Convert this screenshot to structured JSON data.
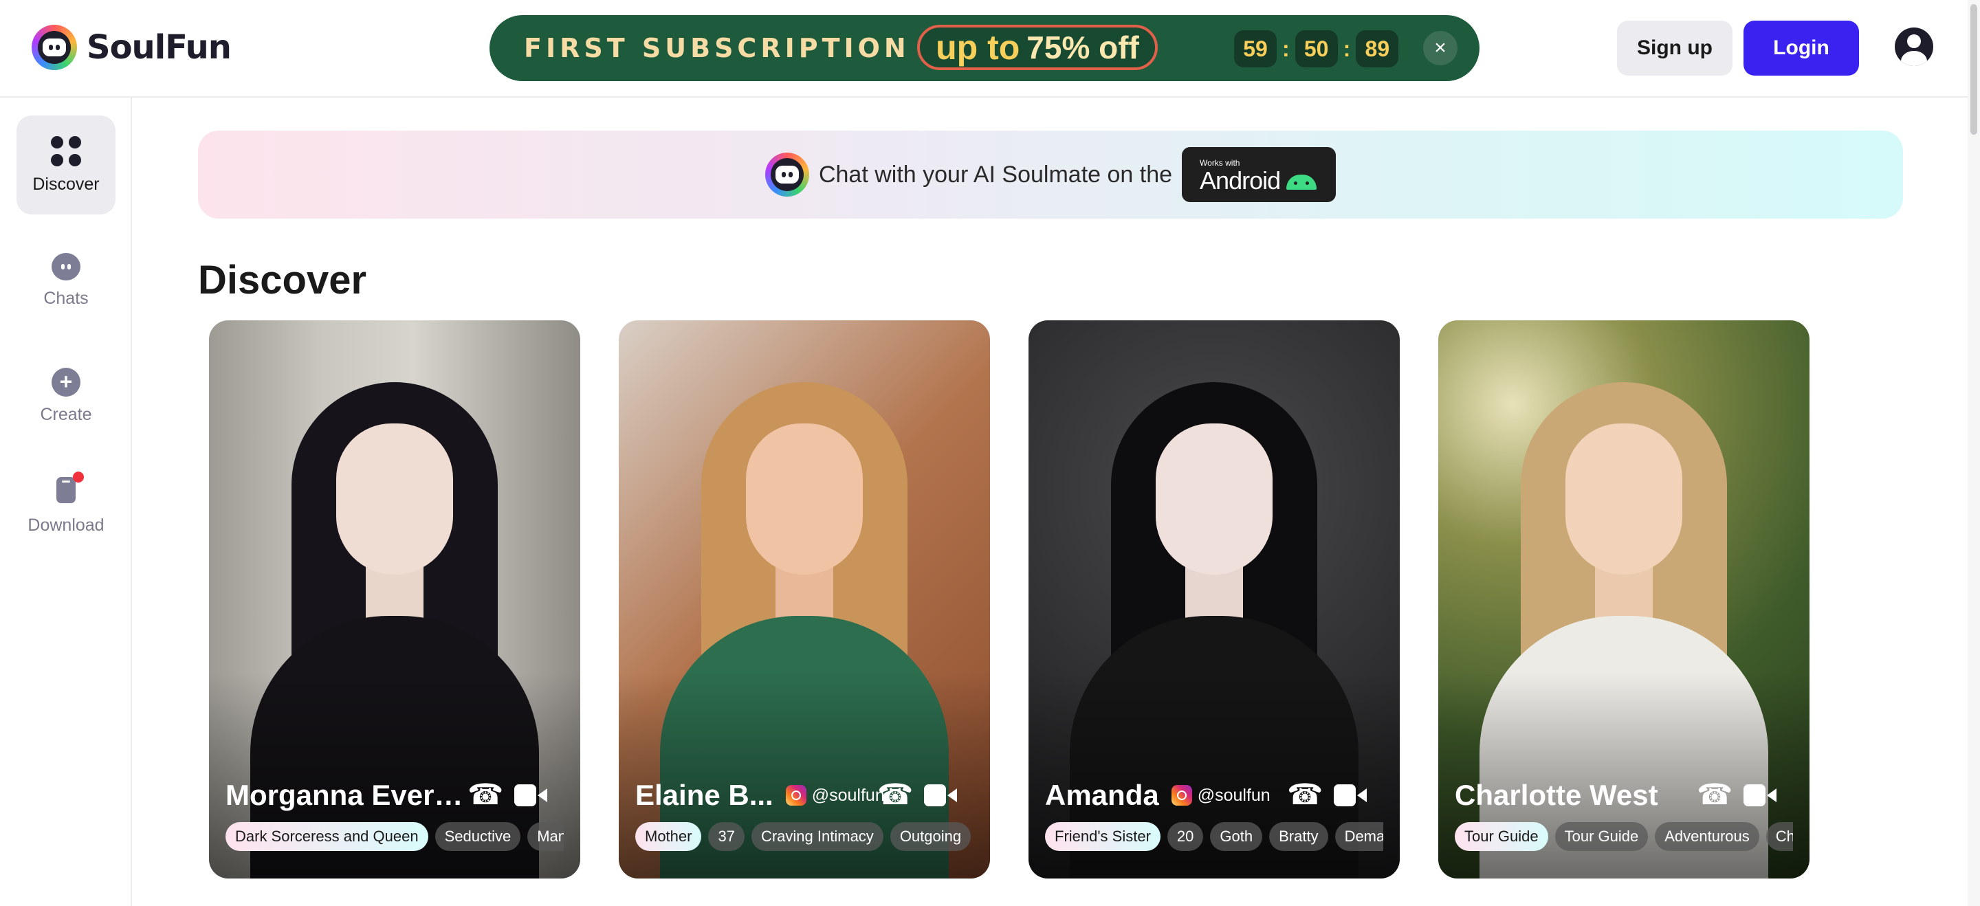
{
  "header": {
    "logo_text": "SoulFun",
    "promo": {
      "title": "FIRST SUBSCRIPTION",
      "up_to": "up to",
      "off": "75% off",
      "countdown": [
        "59",
        "50",
        "89"
      ],
      "close_label": "×"
    },
    "signup_label": "Sign up",
    "login_label": "Login"
  },
  "sidebar": {
    "items": [
      {
        "label": "Discover",
        "icon": "grid-icon",
        "active": true
      },
      {
        "label": "Chats",
        "icon": "chat-icon"
      },
      {
        "label": "Create",
        "icon": "plus-circle-icon"
      },
      {
        "label": "Download",
        "icon": "phone-icon",
        "badge": "red-dot"
      }
    ]
  },
  "banner": {
    "text": "Chat with your AI Soulmate on the",
    "badge_small": "Works with",
    "badge_big": "Android"
  },
  "main": {
    "title": "Discover"
  },
  "cards": [
    {
      "name": "Morganna Everni...",
      "handle": "",
      "tags": [
        "Dark Sorceress and Queen",
        "Seductive",
        "Manip"
      ]
    },
    {
      "name": "Elaine B...",
      "handle": "@soulfun",
      "tags": [
        "Mother",
        "37",
        "Craving Intimacy",
        "Outgoing",
        ""
      ]
    },
    {
      "name": "Amanda",
      "handle": "@soulfun",
      "tags": [
        "Friend's Sister",
        "20",
        "Goth",
        "Bratty",
        "Demanc"
      ]
    },
    {
      "name": "Charlotte West",
      "handle": "",
      "tags": [
        "Tour Guide",
        "Tour Guide",
        "Adventurous",
        "Char"
      ]
    }
  ],
  "colors": {
    "accent": "#3a22f0",
    "promo_bg": "#1e5a3c",
    "promo_gold": "#f7cf5a",
    "nav_active_bg": "#ececf0"
  }
}
